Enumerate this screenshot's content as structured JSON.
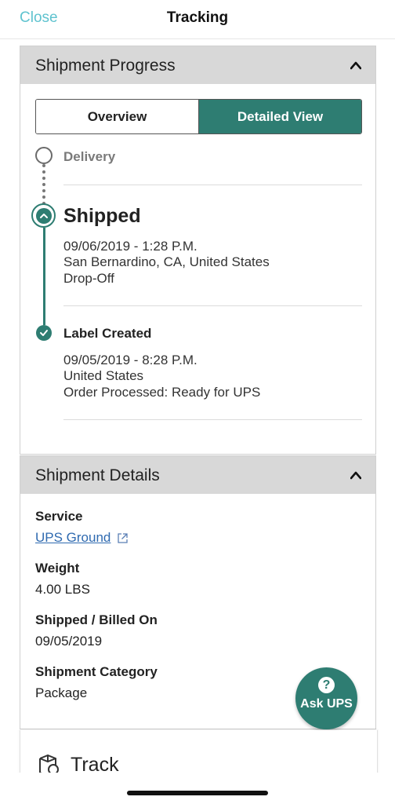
{
  "header": {
    "close_label": "Close",
    "title": "Tracking"
  },
  "progress": {
    "title": "Shipment Progress",
    "tabs": {
      "overview": "Overview",
      "detailed": "Detailed View"
    },
    "events": [
      {
        "status": "Delivery",
        "state": "pending"
      },
      {
        "status": "Shipped",
        "state": "current",
        "datetime": "09/06/2019 - 1:28 P.M.",
        "location": "San Bernardino, CA, United States",
        "activity": "Drop-Off"
      },
      {
        "status": "Label Created",
        "state": "done",
        "datetime": "09/05/2019 - 8:28 P.M.",
        "location": "United States",
        "activity": "Order Processed: Ready for UPS"
      }
    ]
  },
  "details": {
    "title": "Shipment Details",
    "service_label": "Service",
    "service_value": "UPS Ground",
    "weight_label": "Weight",
    "weight_value": "4.00 LBS",
    "billed_label": "Shipped / Billed On",
    "billed_value": "09/05/2019",
    "category_label": "Shipment Category",
    "category_value": "Package"
  },
  "ask_ups": {
    "label": "Ask UPS",
    "icon_glyph": "?"
  },
  "track": {
    "label": "Track"
  },
  "colors": {
    "accent": "#2e7d72",
    "link": "#2f6ab0",
    "close": "#5fc3cf",
    "header_bg": "#d8d8d8"
  }
}
